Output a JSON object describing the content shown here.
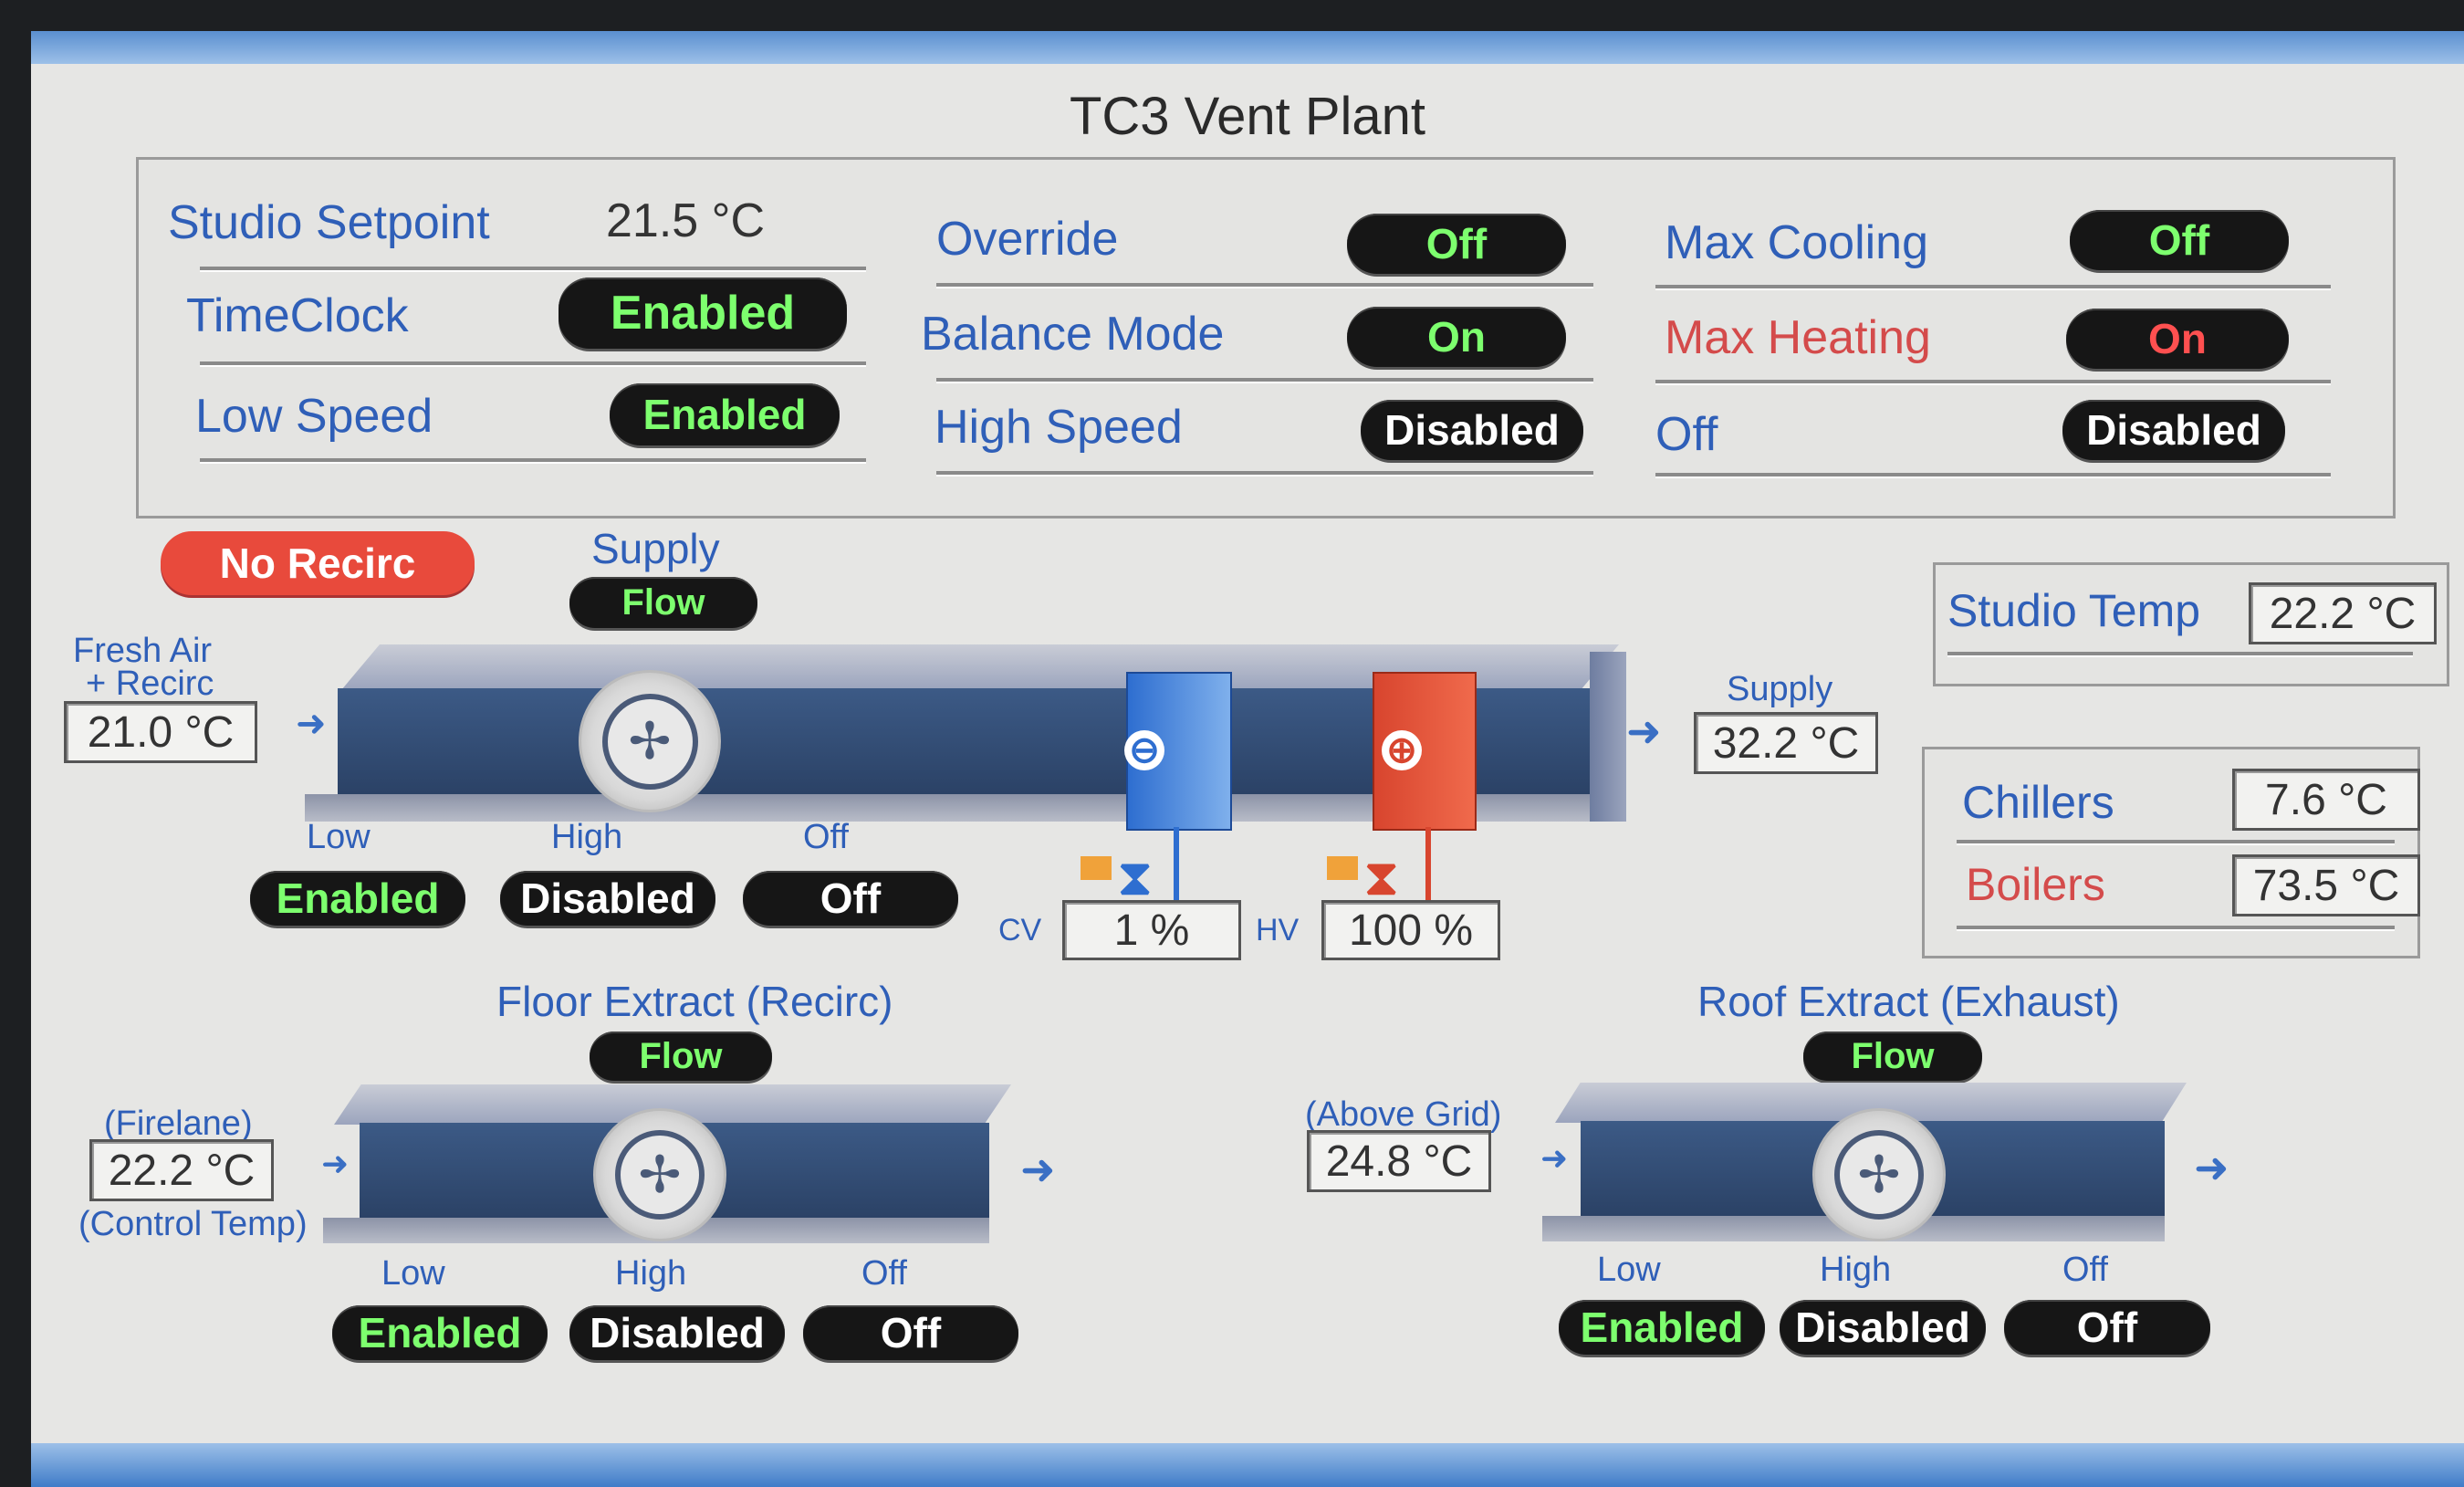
{
  "title": "TC3 Vent Plant",
  "colors": {
    "accent_blue": "#2f5fb8",
    "alarm_red": "#d44b4b",
    "enabled_green": "#7dff6e",
    "recirc_red": "#e84a3c"
  },
  "status": {
    "col1": [
      {
        "label": "Studio Setpoint",
        "value": "21.5 °C"
      },
      {
        "label": "TimeClock",
        "value": "Enabled"
      },
      {
        "label": "Low Speed",
        "value": "Enabled"
      }
    ],
    "col2": [
      {
        "label": "Override",
        "value": "Off"
      },
      {
        "label": "Balance Mode",
        "value": "On"
      },
      {
        "label": "High Speed",
        "value": "Disabled"
      }
    ],
    "col3": [
      {
        "label": "Max Cooling",
        "value": "Off"
      },
      {
        "label": "Max Heating",
        "value": "On"
      },
      {
        "label": "Off",
        "value": "Disabled"
      }
    ]
  },
  "supply": {
    "recirc_badge": "No Recirc",
    "title": "Supply",
    "flow": "Flow",
    "inlet_label_1": "Fresh Air",
    "inlet_label_2": "+ Recirc",
    "inlet_temp": "21.0 °C",
    "outlet_label": "Supply",
    "outlet_temp": "32.2 °C",
    "cooling_symbol": "⊖",
    "heating_symbol": "⊕",
    "cv_label": "CV",
    "cv_value": "1 %",
    "hv_label": "HV",
    "hv_value": "100 %",
    "speed_labels": [
      "Low",
      "High",
      "Off"
    ],
    "speed_values": [
      "Enabled",
      "Disabled",
      "Off"
    ]
  },
  "studio_temp": {
    "label": "Studio Temp",
    "value": "22.2 °C"
  },
  "plant": {
    "chillers_label": "Chillers",
    "chillers_value": "7.6 °C",
    "boilers_label": "Boilers",
    "boilers_value": "73.5 °C"
  },
  "floor_extract": {
    "title": "Floor Extract (Recirc)",
    "flow": "Flow",
    "label_top": "(Firelane)",
    "temp": "22.2 °C",
    "label_bottom": "(Control Temp)",
    "speed_labels": [
      "Low",
      "High",
      "Off"
    ],
    "speed_values": [
      "Enabled",
      "Disabled",
      "Off"
    ]
  },
  "roof_extract": {
    "title": "Roof Extract (Exhaust)",
    "flow": "Flow",
    "label_top": "(Above Grid)",
    "temp": "24.8 °C",
    "speed_labels": [
      "Low",
      "High",
      "Off"
    ],
    "speed_values": [
      "Enabled",
      "Disabled",
      "Off"
    ]
  },
  "icons": {
    "fan": "fan-icon",
    "arrow": "arrow-right-icon",
    "valve": "valve-icon"
  }
}
